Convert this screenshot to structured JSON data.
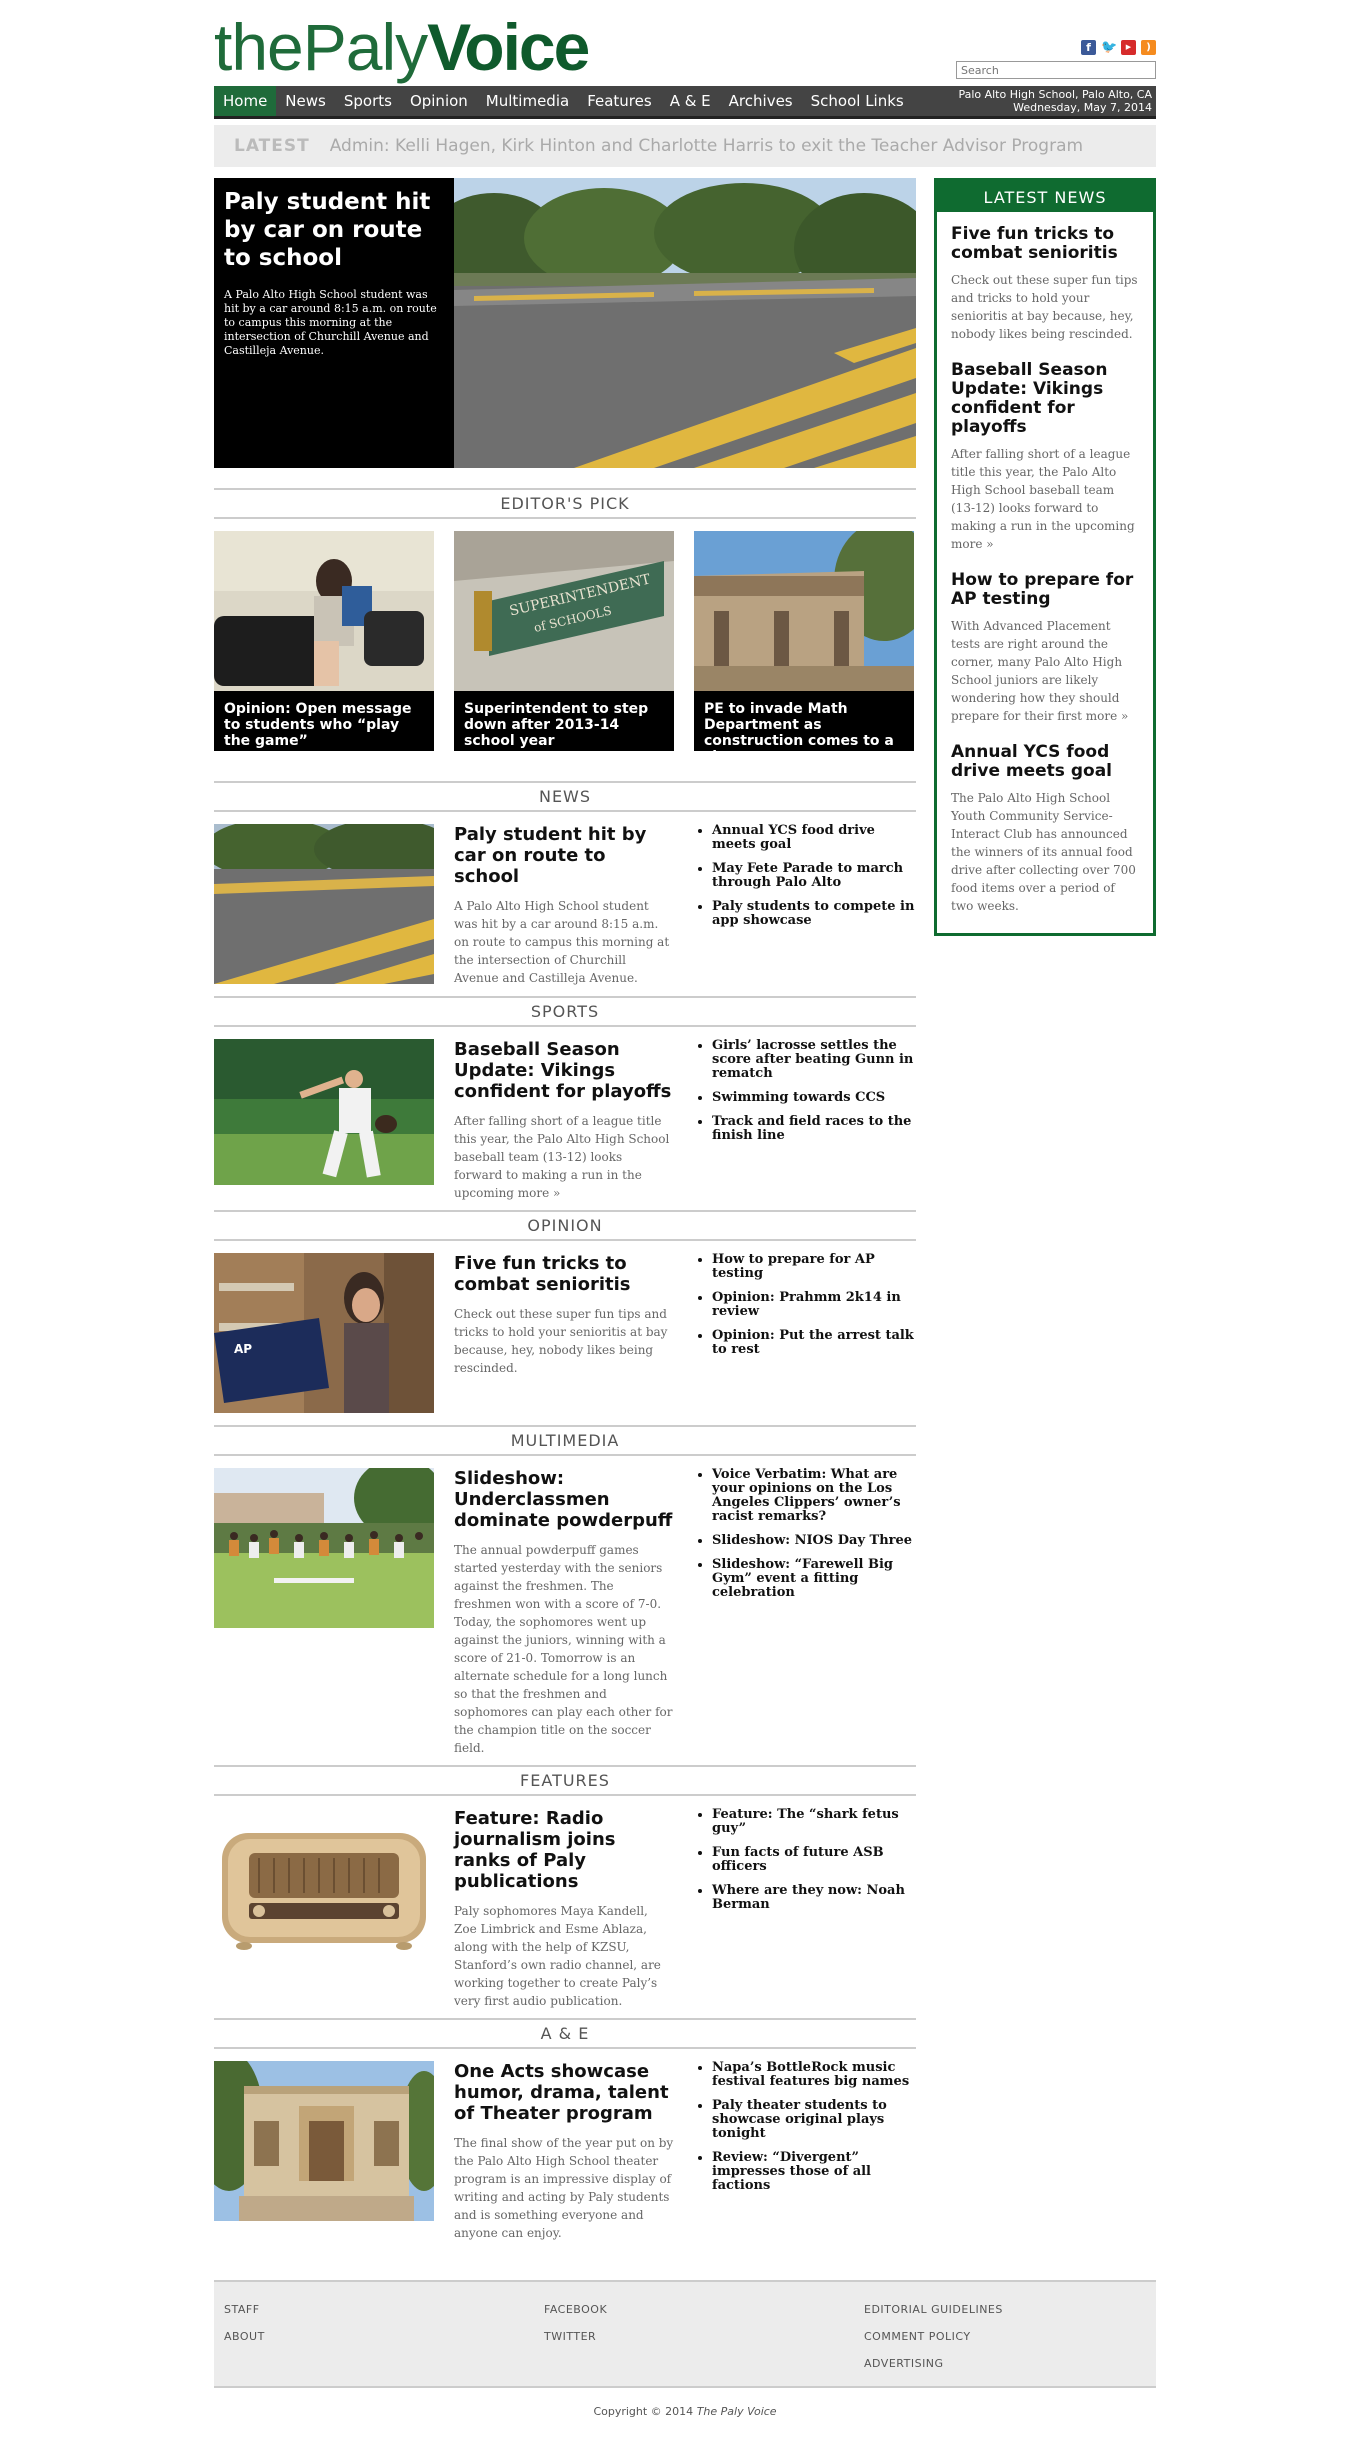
{
  "masthead": {
    "logo_thin": "thePaly",
    "logo_bold": "Voice",
    "search_placeholder": "Search",
    "social_icons": [
      "facebook-icon",
      "twitter-icon",
      "youtube-icon",
      "rss-icon"
    ]
  },
  "nav": {
    "items": [
      "Home",
      "News",
      "Sports",
      "Opinion",
      "Multimedia",
      "Features",
      "A & E",
      "Archives",
      "School Links"
    ],
    "location": "Palo Alto High School, Palo Alto, CA",
    "date": "Wednesday, May 7, 2014"
  },
  "latest": {
    "tag": "LATEST",
    "text": "Admin: Kelli Hagen, Kirk Hinton and Charlotte Harris to exit the Teacher Advisor Program"
  },
  "hero": {
    "title": "Paly student hit by car on route to school",
    "excerpt": "A Palo Alto High School student was hit by a car around 8:15 a.m. on route to campus this morning at the intersection of Churchill Avenue and Castilleja Avenue."
  },
  "editors_pick": {
    "heading": "EDITOR'S PICK",
    "items": [
      "Opinion: Open message to students who “play the game”",
      "Superintendent to step down after 2013-14 school year",
      "PE to invade Math Department as construction comes to a close"
    ]
  },
  "sections": [
    {
      "heading": "NEWS",
      "title": "Paly student hit by car on route to school",
      "excerpt": "A Palo Alto High School student was hit by a car around 8:15 a.m. on route to campus this morning at the intersection of Churchill Avenue and Castilleja Avenue.",
      "links": [
        "Annual YCS food drive meets goal",
        "May Fete Parade to march through Palo Alto",
        "Paly students to compete in app showcase"
      ]
    },
    {
      "heading": "SPORTS",
      "title": "Baseball Season Update: Vikings confident for playoffs",
      "excerpt": "After falling short of a league title this year, the Palo Alto High School baseball team (13-12) looks forward to making a run in the upcoming more »",
      "links": [
        "Girls’ lacrosse settles the score after beating Gunn in rematch",
        "Swimming towards CCS",
        "Track and field races to the finish line"
      ]
    },
    {
      "heading": "OPINION",
      "title": "Five fun tricks to combat senioritis",
      "excerpt": "Check out these super fun tips and tricks to hold your senioritis at bay because, hey, nobody likes being rescinded.",
      "links": [
        "How to prepare for AP testing",
        "Opinion: Prahmm 2k14 in review",
        "Opinion: Put the arrest talk to rest"
      ]
    },
    {
      "heading": "MULTIMEDIA",
      "title": "Slideshow: Underclassmen dominate powderpuff",
      "excerpt": "The annual powderpuff games started yesterday with the seniors against the freshmen. The freshmen won with a score of 7-0. Today, the sophomores went up against the juniors, winning with a score of 21-0. Tomorrow is an alternate schedule for a long lunch so that the freshmen and sophomores can play each other for the champion title on the soccer field.",
      "links": [
        "Voice Verbatim: What are your opinions on the Los Angeles Clippers’ owner’s racist remarks?",
        "Slideshow: NIOS Day Three",
        "Slideshow: “Farewell Big Gym” event a fitting celebration"
      ]
    },
    {
      "heading": "FEATURES",
      "title": "Feature: Radio journalism joins ranks of Paly publications",
      "excerpt": "Paly sophomores Maya Kandell, Zoe Limbrick and Esme Ablaza, along with the help of KZSU, Stanford’s own radio channel, are working together to create Paly’s very first audio publication.",
      "links": [
        "Feature: The “shark fetus guy”",
        "Fun facts of future ASB officers",
        "Where are they now: Noah Berman"
      ]
    },
    {
      "heading": "A & E",
      "title": "One Acts showcase humor, drama, talent of Theater program",
      "excerpt": "The final show of the year put on by the Palo Alto High School theater program is an impressive display of writing and acting by Paly students and is something everyone and anyone can enjoy.",
      "links": [
        "Napa’s BottleRock music festival features big names",
        "Paly theater students to showcase original plays tonight",
        "Review: “Divergent” impresses those of all factions"
      ]
    }
  ],
  "sidebar": {
    "heading": "LATEST NEWS",
    "items": [
      {
        "title": "Five fun tricks to combat senioritis",
        "excerpt": "Check out these super fun tips and tricks to hold your senioritis at bay because, hey, nobody likes being rescinded."
      },
      {
        "title": "Baseball Season Update: Vikings confident for playoffs",
        "excerpt": "After falling short of a league title this year, the Palo Alto High School baseball team (13-12) looks forward to making a run in the upcoming more »"
      },
      {
        "title": "How to prepare for AP testing",
        "excerpt": "With Advanced Placement tests are right around the corner, many Palo Alto High School juniors are likely wondering how they should prepare for their first more »"
      },
      {
        "title": "Annual YCS food drive meets goal",
        "excerpt": "The Palo Alto High School Youth Community Service-Interact Club has announced the winners of its annual food drive after collecting over 700 food items over a period of two weeks."
      }
    ]
  },
  "footer": {
    "col1": [
      "STAFF",
      "ABOUT"
    ],
    "col2": [
      "FACEBOOK",
      "TWITTER"
    ],
    "col3": [
      "EDITORIAL GUIDELINES",
      "COMMENT POLICY",
      "ADVERTISING"
    ],
    "copyright_prefix": "Copyright © 2014",
    "copyright_name": "The Paly Voice"
  }
}
